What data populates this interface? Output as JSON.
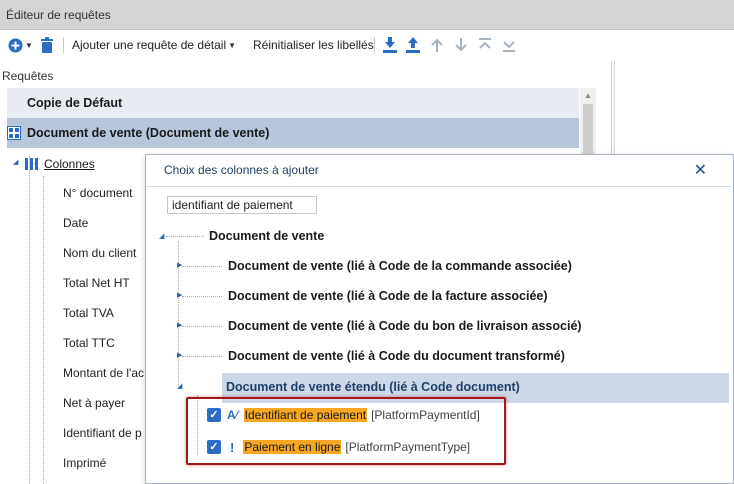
{
  "window": {
    "title": "Éditeur de requêtes"
  },
  "toolbar": {
    "add_detail_label": "Ajouter une requête de détail",
    "reset_labels_label": "Réinitialiser les libellés"
  },
  "left_panel": {
    "label": "Requêtes",
    "rows": {
      "copy_default": "Copie de Défaut",
      "document_vente": "Document de vente (Document de vente)",
      "colonnes": "Colonnes"
    },
    "columns": [
      "N° document",
      "Date",
      "Nom du client",
      "Total Net HT",
      "Total TVA",
      "Total TTC",
      "Montant de l'ac",
      "Net à payer",
      "Identifiant de p",
      "Imprimé"
    ]
  },
  "dialog": {
    "title": "Choix des colonnes à ajouter",
    "search_value": "identifiant de paiement",
    "root": "Document de vente",
    "children": [
      "Document de vente (lié à Code de la commande associée)",
      "Document de vente (lié à Code de la facture associée)",
      "Document de vente (lié à Code du bon de livraison associé)",
      "Document de vente (lié à Code du document transformé)",
      "Document de vente étendu (lié à Code document)"
    ],
    "fields": [
      {
        "label": "Identifiant de paiement",
        "tag": "[PlatformPaymentId]"
      },
      {
        "label": "Paiement en ligne",
        "tag": "[PlatformPaymentType]"
      }
    ]
  },
  "colors": {
    "selection": "#b7c6da",
    "highlight": "#f5a623",
    "accent_blue": "#2b6cc4",
    "focus_border": "#a01818"
  }
}
